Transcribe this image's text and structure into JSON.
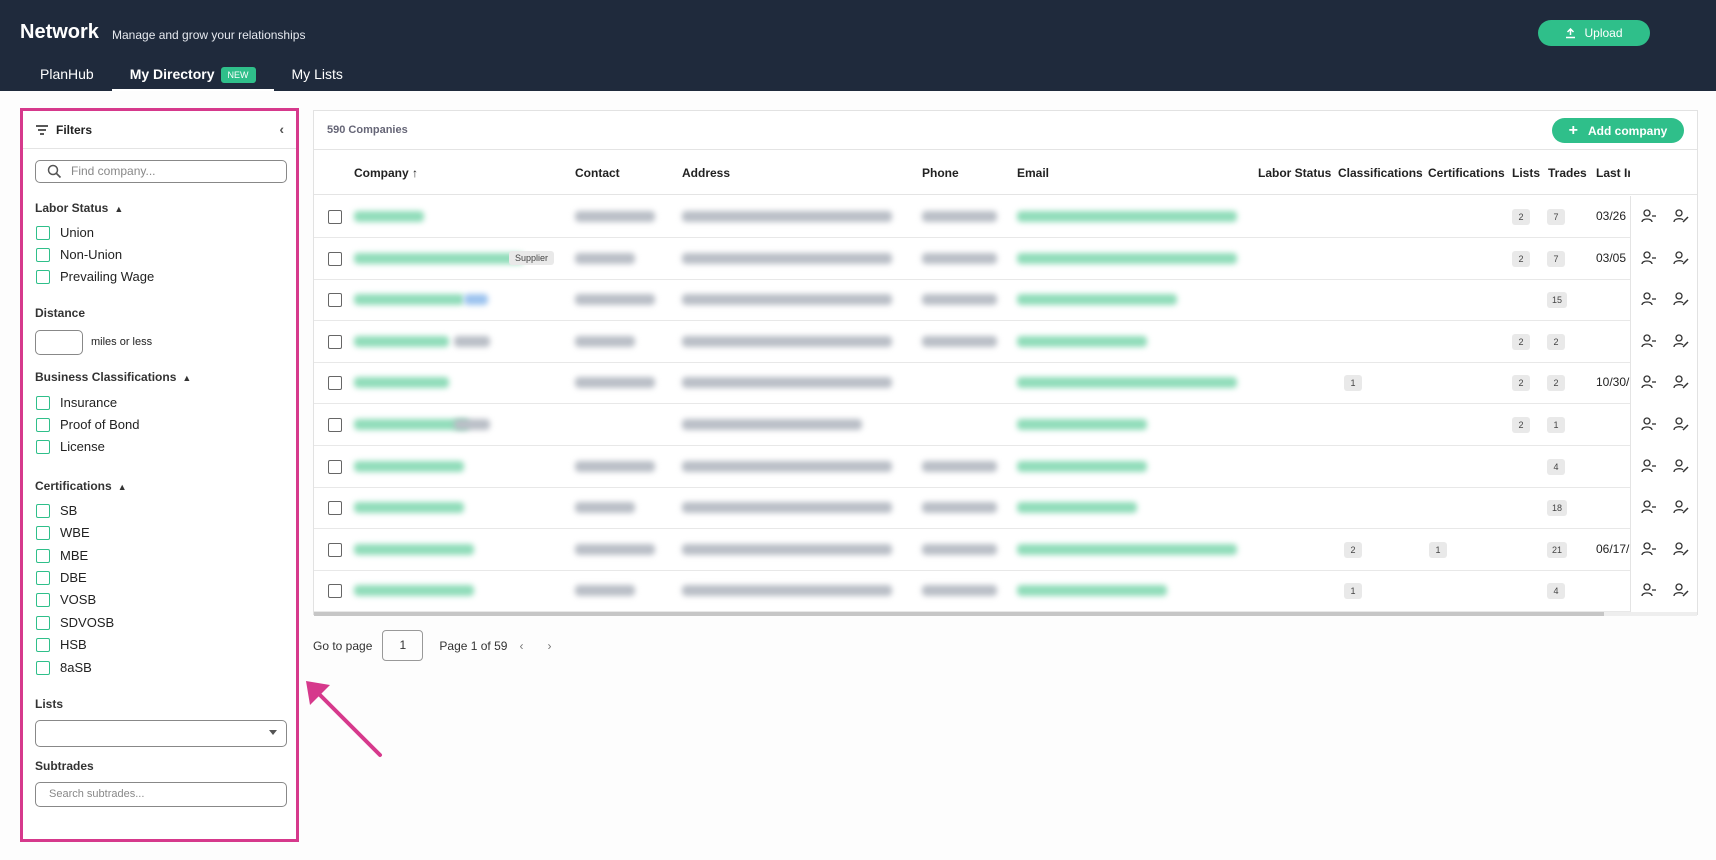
{
  "header": {
    "title": "Network",
    "subtitle": "Manage and grow your relationships",
    "upload_label": "Upload"
  },
  "tabs": [
    {
      "label": "PlanHub"
    },
    {
      "label": "My Directory",
      "badge": "NEW"
    },
    {
      "label": "My Lists"
    }
  ],
  "filters": {
    "title": "Filters",
    "search_placeholder": "Find company...",
    "labor_status": {
      "label": "Labor Status",
      "options": [
        "Union",
        "Non-Union",
        "Prevailing Wage"
      ]
    },
    "distance": {
      "label": "Distance",
      "suffix": "miles or less"
    },
    "business_classifications": {
      "label": "Business Classifications",
      "options": [
        "Insurance",
        "Proof of Bond",
        "License"
      ]
    },
    "certifications": {
      "label": "Certifications",
      "options": [
        "SB",
        "WBE",
        "MBE",
        "DBE",
        "VOSB",
        "SDVOSB",
        "HSB",
        "8aSB"
      ]
    },
    "lists": {
      "label": "Lists"
    },
    "subtrades": {
      "label": "Subtrades",
      "placeholder": "Search subtrades..."
    }
  },
  "table": {
    "count": "590 Companies",
    "add_label": "Add company",
    "columns": [
      "Company",
      "Contact",
      "Address",
      "Phone",
      "Email",
      "Labor Status",
      "Classifications",
      "Certifications",
      "Lists",
      "Trades",
      "Last In"
    ],
    "supplier_tag": "Supplier",
    "rows": [
      {
        "classifications": "",
        "certifications": "",
        "lists": "2",
        "trades": "7",
        "last": "03/26"
      },
      {
        "classifications": "",
        "certifications": "",
        "lists": "2",
        "trades": "7",
        "last": "03/05"
      },
      {
        "classifications": "",
        "certifications": "",
        "lists": "",
        "trades": "15",
        "last": ""
      },
      {
        "classifications": "",
        "certifications": "",
        "lists": "2",
        "trades": "2",
        "last": ""
      },
      {
        "classifications": "1",
        "certifications": "",
        "lists": "2",
        "trades": "2",
        "last": "10/30/"
      },
      {
        "classifications": "",
        "certifications": "",
        "lists": "2",
        "trades": "1",
        "last": ""
      },
      {
        "classifications": "",
        "certifications": "",
        "lists": "",
        "trades": "4",
        "last": ""
      },
      {
        "classifications": "",
        "certifications": "",
        "lists": "",
        "trades": "18",
        "last": ""
      },
      {
        "classifications": "2",
        "certifications": "1",
        "lists": "",
        "trades": "21",
        "last": "06/17/"
      },
      {
        "classifications": "1",
        "certifications": "",
        "lists": "",
        "trades": "4",
        "last": ""
      }
    ]
  },
  "pager": {
    "go_to": "Go to page",
    "page_value": "1",
    "page_of": "Page 1 of 59"
  },
  "colors": {
    "header_bg": "#1f2a3c",
    "accent": "#2fbf8a",
    "highlight": "#d6398c"
  }
}
